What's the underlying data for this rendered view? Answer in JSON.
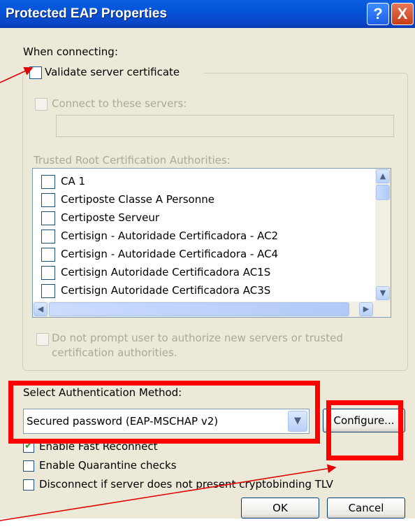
{
  "window": {
    "title": "Protected EAP Properties",
    "help_glyph": "?",
    "close_glyph": "X"
  },
  "when_connecting_label": "When connecting:",
  "validate_server_certificate": {
    "label": "Validate server certificate",
    "checked": false
  },
  "connect_to_servers": {
    "label": "Connect to these servers:",
    "checked": false,
    "value": ""
  },
  "trusted_root_label": "Trusted Root Certification Authorities:",
  "certificate_list": [
    {
      "label": "CA 1",
      "checked": false
    },
    {
      "label": "Certiposte Classe A Personne",
      "checked": false
    },
    {
      "label": "Certiposte Serveur",
      "checked": false
    },
    {
      "label": "Certisign - Autoridade Certificadora - AC2",
      "checked": false
    },
    {
      "label": "Certisign - Autoridade Certificadora - AC4",
      "checked": false
    },
    {
      "label": "Certisign Autoridade Certificadora AC1S",
      "checked": false
    },
    {
      "label": "Certisign Autoridade Certificadora AC3S",
      "checked": false
    }
  ],
  "do_not_prompt": {
    "line1": "Do not prompt user to authorize new servers or trusted",
    "line2": "certification authorities.",
    "checked": false
  },
  "auth_method": {
    "label": "Select Authentication Method:",
    "selected": "Secured password (EAP-MSCHAP v2)",
    "configure_button": "Configure..."
  },
  "enable_fast_reconnect": {
    "label": "Enable Fast Reconnect",
    "checked": true
  },
  "enable_quarantine": {
    "label": "Enable Quarantine checks",
    "checked": false
  },
  "disconnect_cryptobinding": {
    "label": "Disconnect if server does not present cryptobinding TLV",
    "checked": false
  },
  "buttons": {
    "ok": "OK",
    "cancel": "Cancel"
  },
  "annotation_color": "#ff0000",
  "titlebar_color": "#0453d8",
  "dialog_bg_color": "#ece9d8"
}
